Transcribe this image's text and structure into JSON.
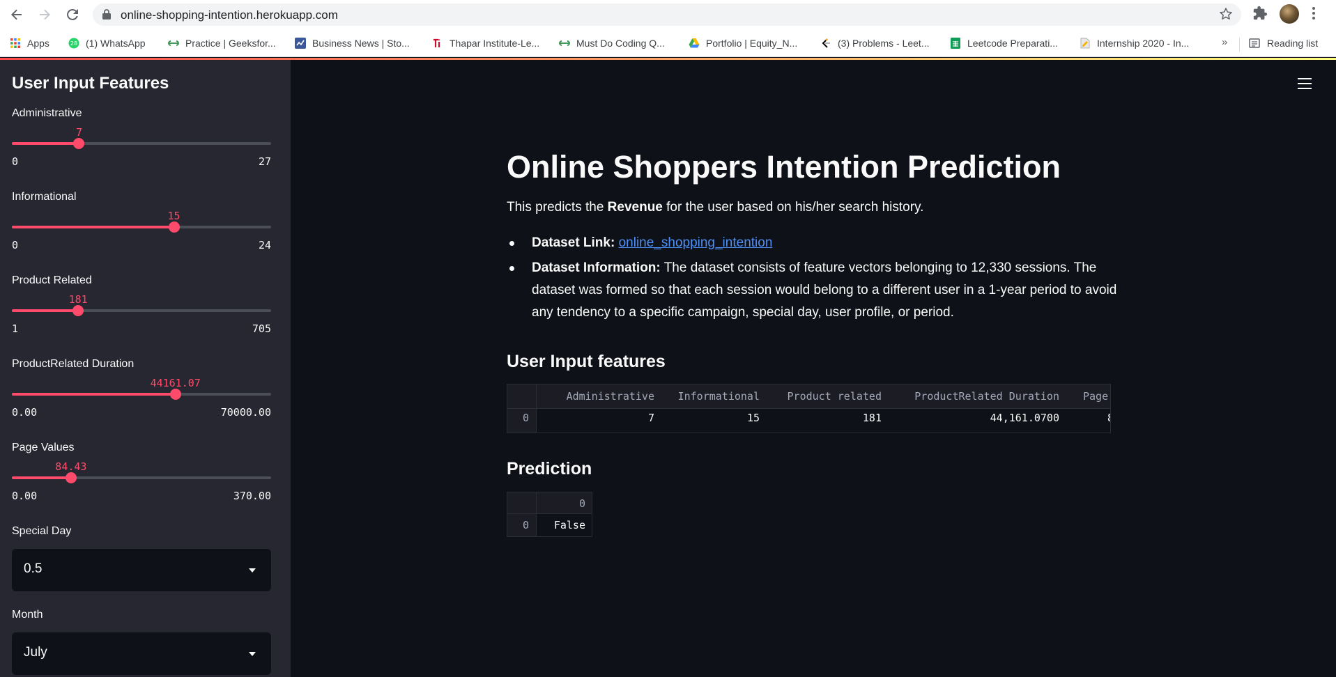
{
  "browser": {
    "url": "online-shopping-intention.herokuapp.com",
    "bookmarks": [
      {
        "label": "Apps",
        "icon": "apps-grid-icon"
      },
      {
        "label": "(1) WhatsApp",
        "icon": "whatsapp-icon",
        "badge": "28"
      },
      {
        "label": "Practice | Geeksfor...",
        "icon": "geeksforgeeks-icon"
      },
      {
        "label": "Business News | Sto...",
        "icon": "news-icon"
      },
      {
        "label": "Thapar Institute-Le...",
        "icon": "thapar-icon"
      },
      {
        "label": "Must Do Coding Q...",
        "icon": "geeksforgeeks-icon"
      },
      {
        "label": "Portfolio | Equity_N...",
        "icon": "drive-icon"
      },
      {
        "label": "(3) Problems - Leet...",
        "icon": "leetcode-icon"
      },
      {
        "label": "Leetcode Preparati...",
        "icon": "sheets-icon"
      },
      {
        "label": "Internship 2020 - In...",
        "icon": "page-icon"
      }
    ],
    "more": "»",
    "reading_list": "Reading list"
  },
  "sidebar": {
    "title": "User Input Features",
    "sliders": [
      {
        "label": "Administrative",
        "value": "7",
        "min": "0",
        "max": "27",
        "fraction": 0.2593
      },
      {
        "label": "Informational",
        "value": "15",
        "min": "0",
        "max": "24",
        "fraction": 0.625
      },
      {
        "label": "Product Related",
        "value": "181",
        "min": "1",
        "max": "705",
        "fraction": 0.2557
      },
      {
        "label": "ProductRelated Duration",
        "value": "44161.07",
        "min": "0.00",
        "max": "70000.00",
        "fraction": 0.6309
      },
      {
        "label": "Page Values",
        "value": "84.43",
        "min": "0.00",
        "max": "370.00",
        "fraction": 0.2282
      }
    ],
    "special_day": {
      "label": "Special Day",
      "value": "0.5"
    },
    "month": {
      "label": "Month",
      "value": "July"
    }
  },
  "main": {
    "title": "Online Shoppers Intention Prediction",
    "intro_prefix": "This predicts the ",
    "intro_bold": "Revenue",
    "intro_suffix": " for the user based on his/her search history.",
    "bullets": {
      "link_label": "Dataset Link:",
      "link_text": "online_shopping_intention",
      "info_label": "Dataset Information:",
      "info_text": "The dataset consists of feature vectors belonging to 12,330 sessions. The dataset was formed so that each session would belong to a different user in a 1-year period to avoid any tendency to a specific campaign, special day, user profile, or period."
    },
    "features_heading": "User Input features",
    "features_table": {
      "columns": [
        "Administrative",
        "Informational",
        "Product related",
        "ProductRelated Duration",
        "Page"
      ],
      "row_index": "0",
      "row": [
        "7",
        "15",
        "181",
        "44,161.0700",
        "8"
      ]
    },
    "prediction_heading": "Prediction",
    "prediction_table": {
      "column": "0",
      "row_index": "0",
      "value": "False"
    }
  },
  "colors": {
    "accent": "#ff4b6b",
    "background": "#0e1117",
    "sidebar": "#262730",
    "link": "#4e8ff7"
  }
}
